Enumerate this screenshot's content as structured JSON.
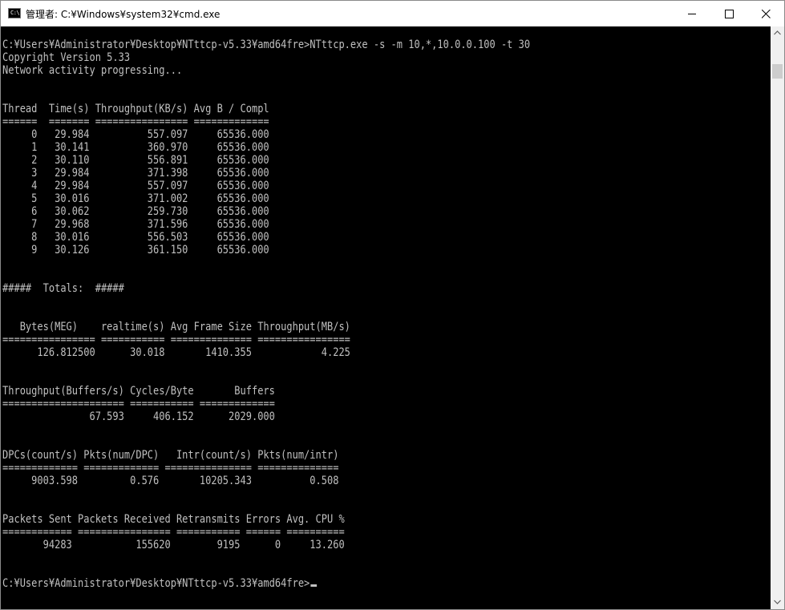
{
  "window": {
    "title": "管理者: C:¥Windows¥system32¥cmd.exe",
    "icon": "cmd-icon",
    "icon_text": "C:\\",
    "controls": {
      "minimize": "minimize-icon",
      "maximize": "maximize-icon",
      "close": "close-icon"
    }
  },
  "console": {
    "lines": [
      "C:¥Users¥Administrator¥Desktop¥NTttcp-v5.33¥amd64fre>NTttcp.exe -s -m 10,*,10.0.0.100 -t 30",
      "Copyright Version 5.33",
      "Network activity progressing...",
      "",
      "",
      "Thread  Time(s) Throughput(KB/s) Avg B / Compl",
      "======  ======= ================ =============",
      "     0   29.984          557.097     65536.000",
      "     1   30.141          360.970     65536.000",
      "     2   30.110          556.891     65536.000",
      "     3   29.984          371.398     65536.000",
      "     4   29.984          557.097     65536.000",
      "     5   30.016          371.002     65536.000",
      "     6   30.062          259.730     65536.000",
      "     7   29.968          371.596     65536.000",
      "     8   30.016          556.503     65536.000",
      "     9   30.126          361.150     65536.000",
      "",
      "",
      "#####  Totals:  #####",
      "",
      "",
      "   Bytes(MEG)    realtime(s) Avg Frame Size Throughput(MB/s)",
      "================ =========== ============== ================",
      "      126.812500      30.018       1410.355            4.225",
      "",
      "",
      "Throughput(Buffers/s) Cycles/Byte       Buffers",
      "===================== =========== =============",
      "               67.593     406.152      2029.000",
      "",
      "",
      "DPCs(count/s) Pkts(num/DPC)   Intr(count/s) Pkts(num/intr)",
      "============= ============= =============== ==============",
      "     9003.598         0.576       10205.343          0.508",
      "",
      "",
      "Packets Sent Packets Received Retransmits Errors Avg. CPU %",
      "============ ================ =========== ====== ==========",
      "       94283           155620        9195      0     13.260",
      "",
      ""
    ],
    "prompt": "C:¥Users¥Administrator¥Desktop¥NTttcp-v5.33¥amd64fre>",
    "text_color": "#c0c0c0",
    "background_color": "#000000"
  },
  "scrollbar": {
    "up": "scroll-up-arrow-icon",
    "down": "scroll-down-arrow-icon"
  }
}
